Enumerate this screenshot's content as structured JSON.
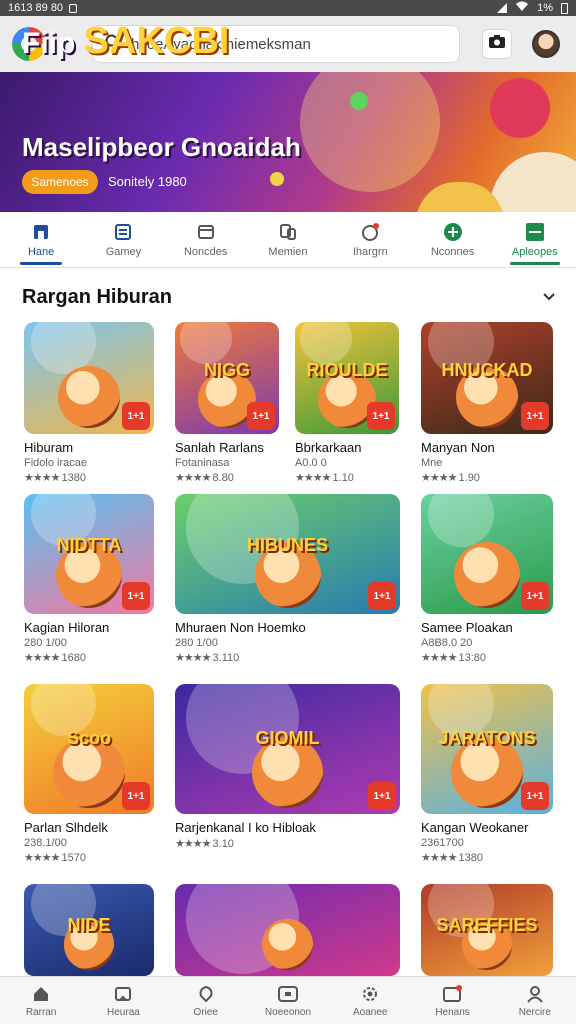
{
  "status": {
    "time": "1613 89 80",
    "battery": "1%"
  },
  "search": {
    "value": "hsoeAyaonakIniemeksman",
    "placeholder": ""
  },
  "banner": {
    "title_prefix": "Fiip",
    "title_accent": "SAKCBI",
    "subtitle": "Maselipbeor Gnoaidah",
    "badge": "Samenoes",
    "meta": "Sonitely 1980"
  },
  "tabs": [
    {
      "label": "Hane"
    },
    {
      "label": "Gamey"
    },
    {
      "label": "Noncdes"
    },
    {
      "label": "Memien"
    },
    {
      "label": "Ihargrn"
    },
    {
      "label": "Nconnes"
    },
    {
      "label": "Apleopes"
    }
  ],
  "section": {
    "title": "Rargan Hiburan"
  },
  "apps": [
    {
      "title": "Hiburam",
      "sub": "Fidolo iracae",
      "rating": "1380",
      "logo": "",
      "badge": "1+1"
    },
    {
      "title": "Sanlah Rarlans",
      "sub": "Fotaninasa",
      "rating": "8.80",
      "logo": "NIGG",
      "badge": "1+1"
    },
    {
      "title": "Bbrkarkaan",
      "sub": "A0.0 0",
      "rating": "1.10",
      "logo": "RIOULDE",
      "badge": "1+1"
    },
    {
      "title": "Manyan Non",
      "sub": "Mne",
      "rating": "1.90",
      "logo": "HNUCKAD",
      "badge": "1+1"
    },
    {
      "title": "Kagian Hiloran",
      "sub": "280 1/00",
      "rating": "1680",
      "logo": "NIDTTA",
      "badge": "1+1"
    },
    {
      "title": "Mhuraen Non Hoemko",
      "sub": "280 1/00",
      "rating": "3.110",
      "logo": "HIBUNES",
      "badge": "1+1"
    },
    {
      "title": "Samee Ploakan",
      "sub": "A8B8.0 20",
      "rating": "13:80",
      "logo": "",
      "badge": "1+1"
    },
    {
      "title": "Parlan Slhdelk",
      "sub": "238.1/00",
      "rating": "1570",
      "logo": "Scoo",
      "badge": "1+1"
    },
    {
      "title": "Rarjenkanal I ko Hibloak",
      "sub": "",
      "rating": "3.10",
      "logo": "GIOMIL",
      "badge": "1+1"
    },
    {
      "title": "Kangan Weokaner",
      "sub": "2361700",
      "rating": "1380",
      "logo": "JARATONS",
      "badge": "1+1"
    },
    {
      "title": "",
      "sub": "",
      "rating": "",
      "logo": "NIDE",
      "badge": ""
    },
    {
      "title": "",
      "sub": "",
      "rating": "",
      "logo": "",
      "badge": ""
    },
    {
      "title": "",
      "sub": "",
      "rating": "",
      "logo": "SAREFFIES",
      "badge": ""
    }
  ],
  "bottom_nav": [
    {
      "label": "Rarran"
    },
    {
      "label": "Heuraa"
    },
    {
      "label": "Oriee"
    },
    {
      "label": "Noeeonon"
    },
    {
      "label": "Aoanee"
    },
    {
      "label": "Henans"
    },
    {
      "label": "Nercire"
    }
  ],
  "colors": {
    "accent": "#1a4fa0",
    "green": "#1b8a4a",
    "badge": "#e53a2a",
    "banner_badge": "#f39c1a"
  }
}
